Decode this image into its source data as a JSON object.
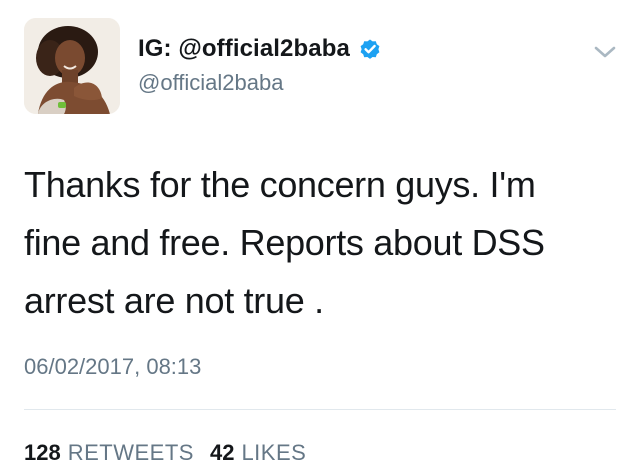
{
  "user": {
    "display_name": "IG: @official2baba",
    "handle": "@official2baba",
    "verified": true,
    "verified_color": "#1da1f2"
  },
  "icons": {
    "verified": "verified-badge-icon",
    "menu": "chevron-down-icon"
  },
  "tweet": {
    "text_lines": [
      "Thanks for the concern guys. I'm",
      "fine and free. Reports about DSS",
      "arrest are not true ."
    ],
    "timestamp": "06/02/2017, 08:13"
  },
  "stats": {
    "retweets_count": "128",
    "retweets_label": "RETWEETS",
    "likes_count": "42",
    "likes_label": "LIKES"
  }
}
